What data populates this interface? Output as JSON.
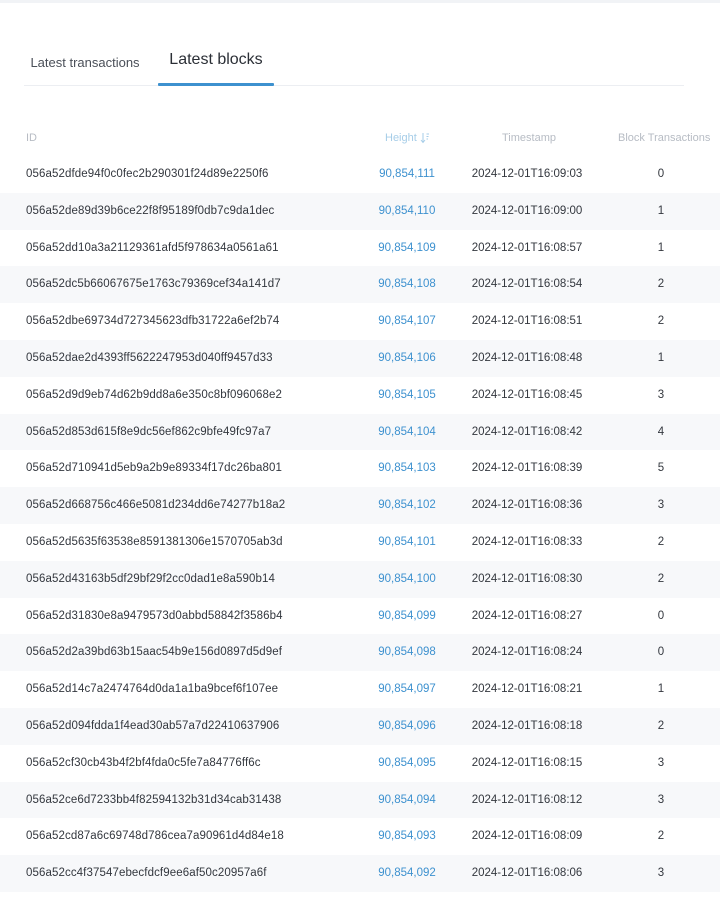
{
  "tabs": [
    {
      "label": "Latest transactions"
    },
    {
      "label": "Latest blocks"
    }
  ],
  "active_tab": "Latest blocks",
  "table": {
    "headers": {
      "id": "ID",
      "height": "Height",
      "timestamp": "Timestamp",
      "block_transactions": "Block Transactions"
    },
    "rows": [
      {
        "id": "056a52dfde94f0c0fec2b290301f24d89e2250f6",
        "height": "90,854,111",
        "timestamp": "2024-12-01T16:09:03",
        "tx": "0"
      },
      {
        "id": "056a52de89d39b6ce22f8f95189f0db7c9da1dec",
        "height": "90,854,110",
        "timestamp": "2024-12-01T16:09:00",
        "tx": "1"
      },
      {
        "id": "056a52dd10a3a21129361afd5f978634a0561a61",
        "height": "90,854,109",
        "timestamp": "2024-12-01T16:08:57",
        "tx": "1"
      },
      {
        "id": "056a52dc5b66067675e1763c79369cef34a141d7",
        "height": "90,854,108",
        "timestamp": "2024-12-01T16:08:54",
        "tx": "2"
      },
      {
        "id": "056a52dbe69734d727345623dfb31722a6ef2b74",
        "height": "90,854,107",
        "timestamp": "2024-12-01T16:08:51",
        "tx": "2"
      },
      {
        "id": "056a52dae2d4393ff5622247953d040ff9457d33",
        "height": "90,854,106",
        "timestamp": "2024-12-01T16:08:48",
        "tx": "1"
      },
      {
        "id": "056a52d9d9eb74d62b9dd8a6e350c8bf096068e2",
        "height": "90,854,105",
        "timestamp": "2024-12-01T16:08:45",
        "tx": "3"
      },
      {
        "id": "056a52d853d615f8e9dc56ef862c9bfe49fc97a7",
        "height": "90,854,104",
        "timestamp": "2024-12-01T16:08:42",
        "tx": "4"
      },
      {
        "id": "056a52d710941d5eb9a2b9e89334f17dc26ba801",
        "height": "90,854,103",
        "timestamp": "2024-12-01T16:08:39",
        "tx": "5"
      },
      {
        "id": "056a52d668756c466e5081d234dd6e74277b18a2",
        "height": "90,854,102",
        "timestamp": "2024-12-01T16:08:36",
        "tx": "3"
      },
      {
        "id": "056a52d5635f63538e8591381306e1570705ab3d",
        "height": "90,854,101",
        "timestamp": "2024-12-01T16:08:33",
        "tx": "2"
      },
      {
        "id": "056a52d43163b5df29bf29f2cc0dad1e8a590b14",
        "height": "90,854,100",
        "timestamp": "2024-12-01T16:08:30",
        "tx": "2"
      },
      {
        "id": "056a52d31830e8a9479573d0abbd58842f3586b4",
        "height": "90,854,099",
        "timestamp": "2024-12-01T16:08:27",
        "tx": "0"
      },
      {
        "id": "056a52d2a39bd63b15aac54b9e156d0897d5d9ef",
        "height": "90,854,098",
        "timestamp": "2024-12-01T16:08:24",
        "tx": "0"
      },
      {
        "id": "056a52d14c7a2474764d0da1a1ba9bcef6f107ee",
        "height": "90,854,097",
        "timestamp": "2024-12-01T16:08:21",
        "tx": "1"
      },
      {
        "id": "056a52d094fdda1f4ead30ab57a7d22410637906",
        "height": "90,854,096",
        "timestamp": "2024-12-01T16:08:18",
        "tx": "2"
      },
      {
        "id": "056a52cf30cb43b4f2bf4fda0c5fe7a84776ff6c",
        "height": "90,854,095",
        "timestamp": "2024-12-01T16:08:15",
        "tx": "3"
      },
      {
        "id": "056a52ce6d7233bb4f82594132b31d34cab31438",
        "height": "90,854,094",
        "timestamp": "2024-12-01T16:08:12",
        "tx": "3"
      },
      {
        "id": "056a52cd87a6c69748d786cea7a90961d4d84e18",
        "height": "90,854,093",
        "timestamp": "2024-12-01T16:08:09",
        "tx": "2"
      },
      {
        "id": "056a52cc4f37547ebecfdcf9ee6af50c20957a6f",
        "height": "90,854,092",
        "timestamp": "2024-12-01T16:08:06",
        "tx": "3"
      }
    ]
  },
  "icons": {
    "sort": "sort-descending-icon"
  },
  "colors": {
    "accent": "#3d91cf",
    "header_text": "#b7bcc4",
    "stripe": "#f7f8fa"
  }
}
